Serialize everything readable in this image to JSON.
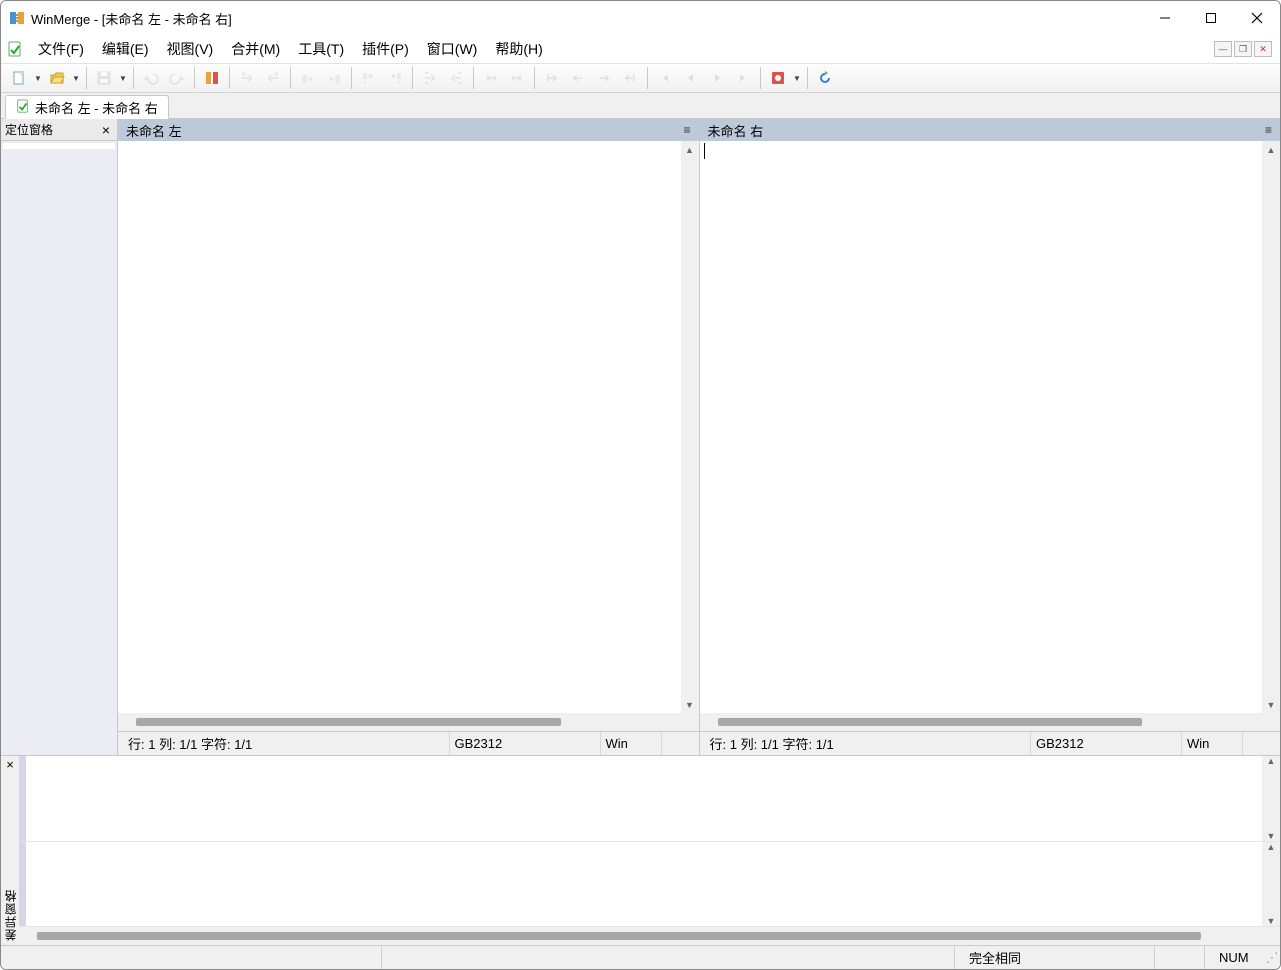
{
  "title": "WinMerge - [未命名 左 - 未命名 右]",
  "menu": {
    "file": "文件(F)",
    "edit": "编辑(E)",
    "view": "视图(V)",
    "merge": "合并(M)",
    "tools": "工具(T)",
    "plugins": "插件(P)",
    "window": "窗口(W)",
    "help": "帮助(H)"
  },
  "doc_tab": "未命名 左 - 未命名 右",
  "locator": {
    "title": "定位窗格"
  },
  "panes": {
    "left": {
      "title": "未命名 左",
      "status_pos": "行: 1  列: 1/1  字符: 1/1",
      "encoding": "GB2312",
      "eol": "Win"
    },
    "right": {
      "title": "未命名 右",
      "status_pos": "行: 1  列: 1/1  字符: 1/1",
      "encoding": "GB2312",
      "eol": "Win"
    }
  },
  "diff_label": "差异窗格",
  "statusbar": {
    "status": "完全相同",
    "num": "NUM"
  },
  "icons": {
    "app": "winmerge",
    "doc": "doc-check"
  }
}
